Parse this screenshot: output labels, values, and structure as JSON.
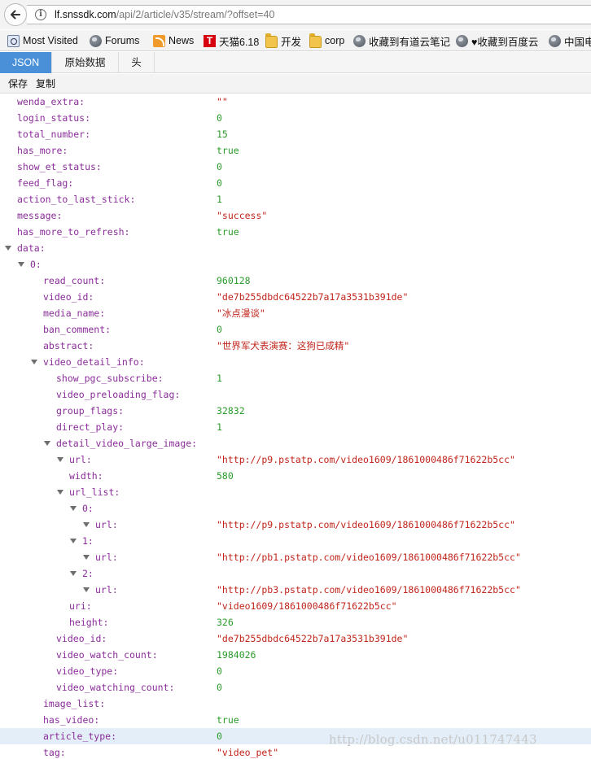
{
  "address_bar": {
    "host": "lf.snssdk.com",
    "path": "/api/2/article/v35/stream/?offset=40"
  },
  "bookmarks": [
    {
      "label": "Most Visited",
      "icon": "most-visited-icon"
    },
    {
      "label": "Forums",
      "icon": "globe-icon"
    },
    {
      "label": "News",
      "icon": "rss-icon"
    },
    {
      "label": "天猫6.18",
      "icon": "tmall-icon"
    },
    {
      "label": "开发",
      "icon": "folder-icon"
    },
    {
      "label": "corp",
      "icon": "folder-icon"
    },
    {
      "label": "收藏到有道云笔记",
      "icon": "globe-icon"
    },
    {
      "label": "♥收藏到百度云",
      "icon": "globe-icon"
    },
    {
      "label": "中国电",
      "icon": "globe-icon"
    }
  ],
  "viewer_tabs": [
    {
      "label": "JSON",
      "active": true
    },
    {
      "label": "原始数据",
      "active": false
    },
    {
      "label": "头",
      "active": false
    }
  ],
  "toolbar": {
    "save": "保存",
    "copy": "复制"
  },
  "tree": [
    {
      "key": "wenda_extra:",
      "value": "\"\"",
      "type": "string",
      "depth": 0
    },
    {
      "key": "login_status:",
      "value": "0",
      "type": "number",
      "depth": 0
    },
    {
      "key": "total_number:",
      "value": "15",
      "type": "number",
      "depth": 0
    },
    {
      "key": "has_more:",
      "value": "true",
      "type": "bool",
      "depth": 0
    },
    {
      "key": "show_et_status:",
      "value": "0",
      "type": "number",
      "depth": 0
    },
    {
      "key": "feed_flag:",
      "value": "0",
      "type": "number",
      "depth": 0
    },
    {
      "key": "action_to_last_stick:",
      "value": "1",
      "type": "number",
      "depth": 0
    },
    {
      "key": "message:",
      "value": "\"success\"",
      "type": "string",
      "depth": 0
    },
    {
      "key": "has_more_to_refresh:",
      "value": "true",
      "type": "bool",
      "depth": 0
    },
    {
      "key": "data:",
      "value": "",
      "type": "node",
      "depth": 0,
      "expanded": true
    },
    {
      "key": "0:",
      "value": "",
      "type": "node",
      "depth": 1,
      "expanded": true
    },
    {
      "key": "read_count:",
      "value": "960128",
      "type": "number",
      "depth": 2
    },
    {
      "key": "video_id:",
      "value": "\"de7b255dbdc64522b7a17a3531b391de\"",
      "type": "string",
      "depth": 2
    },
    {
      "key": "media_name:",
      "value": "\"冰点漫谈\"",
      "type": "string",
      "depth": 2
    },
    {
      "key": "ban_comment:",
      "value": "0",
      "type": "number",
      "depth": 2
    },
    {
      "key": "abstract:",
      "value": "\"世界军犬表演赛：这狗已成精\"",
      "type": "string",
      "depth": 2
    },
    {
      "key": "video_detail_info:",
      "value": "",
      "type": "node",
      "depth": 2,
      "expanded": true
    },
    {
      "key": "show_pgc_subscribe:",
      "value": "1",
      "type": "number",
      "depth": 3
    },
    {
      "key": "video_preloading_flag:",
      "value": "",
      "type": "empty",
      "depth": 3
    },
    {
      "key": "group_flags:",
      "value": "32832",
      "type": "number",
      "depth": 3
    },
    {
      "key": "direct_play:",
      "value": "1",
      "type": "number",
      "depth": 3
    },
    {
      "key": "detail_video_large_image:",
      "value": "",
      "type": "node",
      "depth": 3,
      "expanded": true
    },
    {
      "key": "url:",
      "value": "\"http://p9.pstatp.com/video1609/1861000486f71622b5cc\"",
      "type": "string",
      "depth": 4,
      "twisty": true
    },
    {
      "key": "width:",
      "value": "580",
      "type": "number",
      "depth": 4
    },
    {
      "key": "url_list:",
      "value": "",
      "type": "node",
      "depth": 4,
      "expanded": true
    },
    {
      "key": "0:",
      "value": "",
      "type": "node",
      "depth": 5,
      "expanded": true
    },
    {
      "key": "url:",
      "value": "\"http://p9.pstatp.com/video1609/1861000486f71622b5cc\"",
      "type": "string",
      "depth": 6,
      "twisty": true
    },
    {
      "key": "1:",
      "value": "",
      "type": "node",
      "depth": 5,
      "expanded": true
    },
    {
      "key": "url:",
      "value": "\"http://pb1.pstatp.com/video1609/1861000486f71622b5cc\"",
      "type": "string",
      "depth": 6,
      "twisty": true
    },
    {
      "key": "2:",
      "value": "",
      "type": "node",
      "depth": 5,
      "expanded": true
    },
    {
      "key": "url:",
      "value": "\"http://pb3.pstatp.com/video1609/1861000486f71622b5cc\"",
      "type": "string",
      "depth": 6,
      "twisty": true
    },
    {
      "key": "uri:",
      "value": "\"video1609/1861000486f71622b5cc\"",
      "type": "string",
      "depth": 4
    },
    {
      "key": "height:",
      "value": "326",
      "type": "number",
      "depth": 4
    },
    {
      "key": "video_id:",
      "value": "\"de7b255dbdc64522b7a17a3531b391de\"",
      "type": "string",
      "depth": 3
    },
    {
      "key": "video_watch_count:",
      "value": "1984026",
      "type": "number",
      "depth": 3
    },
    {
      "key": "video_type:",
      "value": "0",
      "type": "number",
      "depth": 3
    },
    {
      "key": "video_watching_count:",
      "value": "0",
      "type": "number",
      "depth": 3
    },
    {
      "key": "image_list:",
      "value": "",
      "type": "empty",
      "depth": 2
    },
    {
      "key": "has_video:",
      "value": "true",
      "type": "bool",
      "depth": 2
    },
    {
      "key": "article_type:",
      "value": "0",
      "type": "number",
      "depth": 2,
      "highlight": true
    },
    {
      "key": "tag:",
      "value": "\"video_pet\"",
      "type": "string",
      "depth": 2
    }
  ],
  "watermark": "http://blog.csdn.net/u011747443",
  "colors": {
    "key": "#8a2d99",
    "string": "#c1251b",
    "number": "#2a9c2a",
    "active_tab": "#4a90d9",
    "row_highlight": "#e4eef8"
  }
}
